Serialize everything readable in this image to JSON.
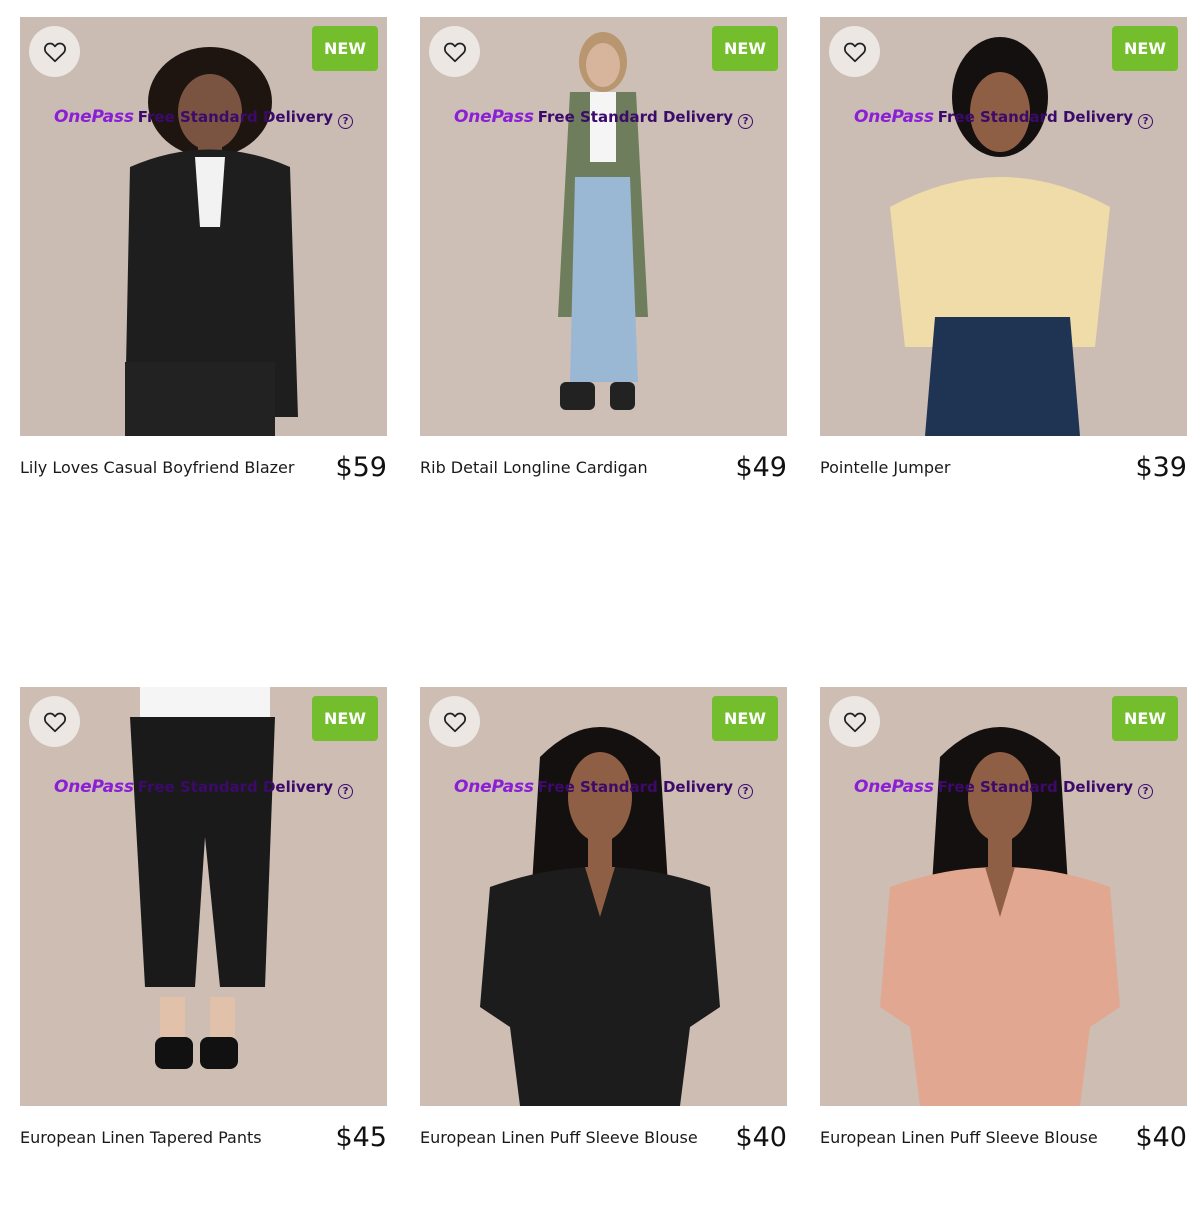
{
  "products": [
    {
      "name": "Lily Loves Casual Boyfriend Blazer",
      "price": "$59",
      "badge": "NEW",
      "image": "woman-in-black-pinstripe-blazer",
      "garment_color": "#1e1e1e",
      "background_color": "#cbbcb3",
      "skin_color": "#7a5440",
      "hair_color": "#1e1511"
    },
    {
      "name": "Rib Detail Longline Cardigan",
      "price": "$49",
      "badge": "NEW",
      "image": "woman-in-green-longline-cardigan",
      "garment_color": "#6e7d5c",
      "background_color": "#cdbfb5",
      "skin_color": "#d7b49c",
      "hair_color": "#b89670"
    },
    {
      "name": "Pointelle Jumper",
      "price": "$39",
      "badge": "NEW",
      "image": "woman-in-yellow-knit-jumper",
      "garment_color": "#f0dca9",
      "background_color": "#cbbdb4",
      "skin_color": "#8f5f45",
      "hair_color": "#151010"
    },
    {
      "name": "European Linen Tapered Pants",
      "price": "$45",
      "badge": "NEW",
      "image": "black-linen-tapered-pants",
      "garment_color": "#1a1a1a",
      "background_color": "#cdbdb3",
      "skin_color": "#e2c1ab",
      "hair_color": "#1a1a1a"
    },
    {
      "name": "European Linen Puff Sleeve Blouse",
      "price": "$40",
      "badge": "NEW",
      "image": "woman-in-black-linen-blouse",
      "garment_color": "#1c1c1c",
      "background_color": "#cdbdb3",
      "skin_color": "#8f5f45",
      "hair_color": "#151010"
    },
    {
      "name": "European Linen Puff Sleeve Blouse",
      "price": "$40",
      "badge": "NEW",
      "image": "woman-in-pink-linen-blouse",
      "garment_color": "#e2a790",
      "background_color": "#cdbdb3",
      "skin_color": "#8f5f45",
      "hair_color": "#151010"
    }
  ],
  "delivery": {
    "brand": "OnePass",
    "text": "Free Standard Delivery",
    "help_symbol": "?"
  },
  "colors": {
    "badge": "#74bd2c",
    "brand": "#8a1fd6",
    "delivery_text": "#3b0a6b"
  },
  "icons": {
    "wishlist": "heart-outline-icon",
    "help": "question-circle-icon"
  }
}
